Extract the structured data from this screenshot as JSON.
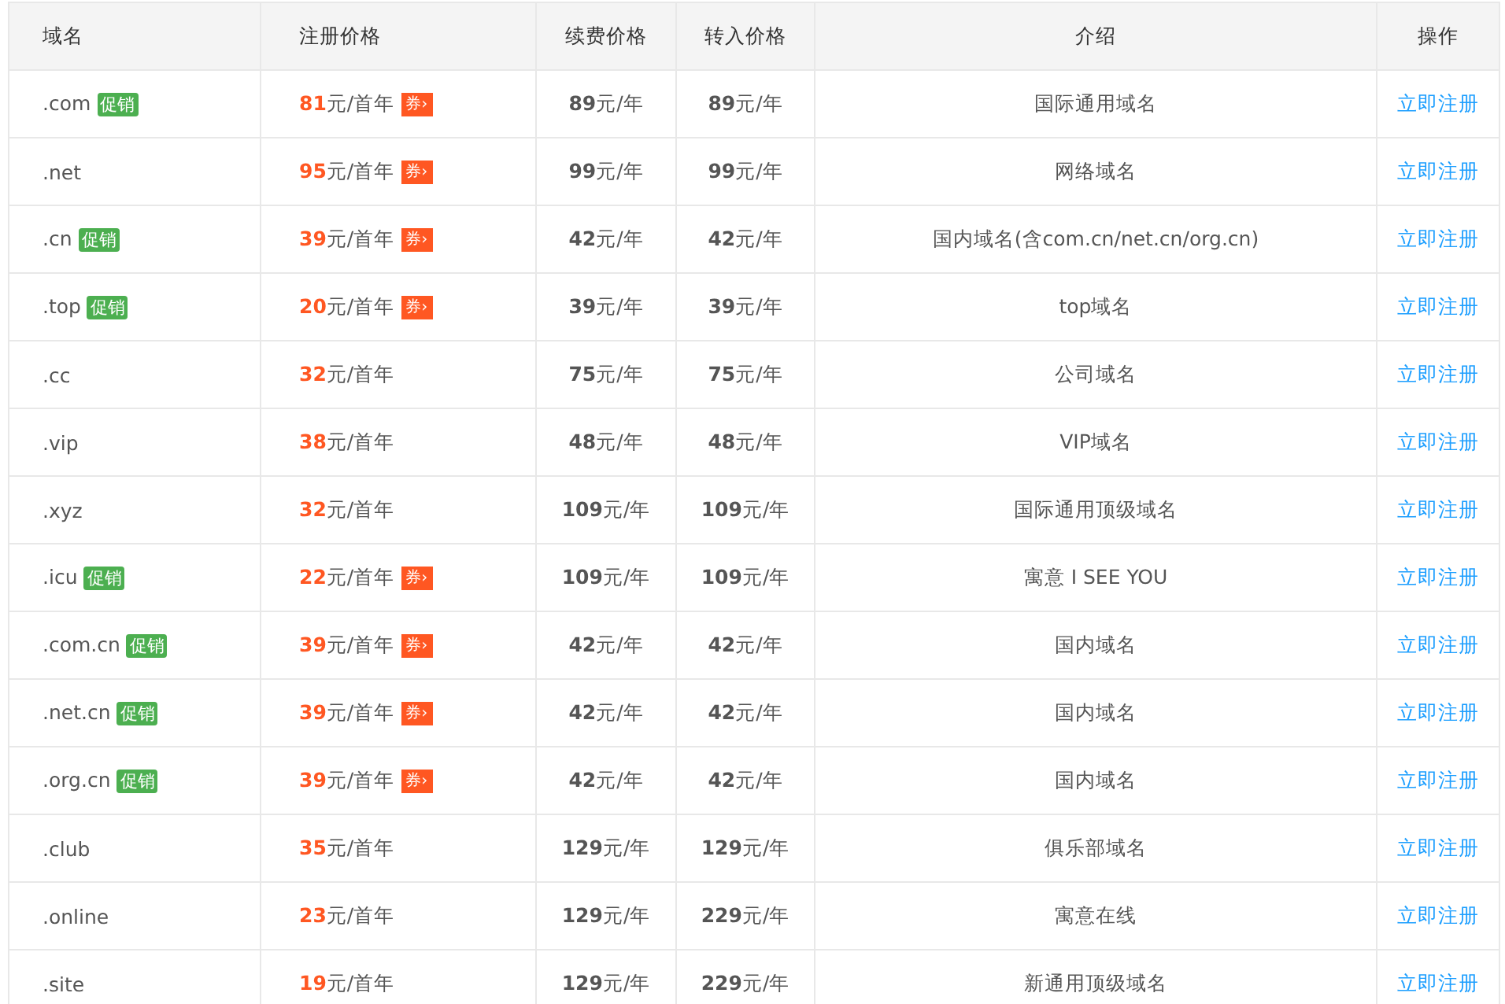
{
  "table": {
    "columns": [
      "域名",
      "注册价格",
      "续费价格",
      "转入价格",
      "介绍",
      "操作"
    ],
    "rows": [
      {
        "domain": ".com",
        "badge": "促销",
        "reg_price": "81",
        "reg_unit": "元/首年",
        "coupon": "券›",
        "renew_price": "89",
        "renew_unit": "元/年",
        "transfer_price": "89",
        "transfer_unit": "元/年",
        "intro": "国际通用域名",
        "action": "立即注册"
      },
      {
        "domain": ".net",
        "reg_price": "95",
        "reg_unit": "元/首年",
        "coupon": "券›",
        "renew_price": "99",
        "renew_unit": "元/年",
        "transfer_price": "99",
        "transfer_unit": "元/年",
        "intro": "网络域名",
        "action": "立即注册"
      },
      {
        "domain": ".cn",
        "badge": "促销",
        "reg_price": "39",
        "reg_unit": "元/首年",
        "coupon": "券›",
        "renew_price": "42",
        "renew_unit": "元/年",
        "transfer_price": "42",
        "transfer_unit": "元/年",
        "intro": "国内域名(含com.cn/net.cn/org.cn)",
        "action": "立即注册"
      },
      {
        "domain": ".top",
        "badge": "促销",
        "reg_price": "20",
        "reg_unit": "元/首年",
        "coupon": "券›",
        "renew_price": "39",
        "renew_unit": "元/年",
        "transfer_price": "39",
        "transfer_unit": "元/年",
        "intro": "top域名",
        "action": "立即注册"
      },
      {
        "domain": ".cc",
        "reg_price": "32",
        "reg_unit": "元/首年",
        "renew_price": "75",
        "renew_unit": "元/年",
        "transfer_price": "75",
        "transfer_unit": "元/年",
        "intro": "公司域名",
        "action": "立即注册"
      },
      {
        "domain": ".vip",
        "reg_price": "38",
        "reg_unit": "元/首年",
        "renew_price": "48",
        "renew_unit": "元/年",
        "transfer_price": "48",
        "transfer_unit": "元/年",
        "intro": "VIP域名",
        "action": "立即注册"
      },
      {
        "domain": ".xyz",
        "reg_price": "32",
        "reg_unit": "元/首年",
        "renew_price": "109",
        "renew_unit": "元/年",
        "transfer_price": "109",
        "transfer_unit": "元/年",
        "intro": "国际通用顶级域名",
        "action": "立即注册"
      },
      {
        "domain": ".icu",
        "badge": "促销",
        "reg_price": "22",
        "reg_unit": "元/首年",
        "coupon": "券›",
        "renew_price": "109",
        "renew_unit": "元/年",
        "transfer_price": "109",
        "transfer_unit": "元/年",
        "intro": "寓意 I SEE YOU",
        "action": "立即注册"
      },
      {
        "domain": ".com.cn",
        "badge": "促销",
        "reg_price": "39",
        "reg_unit": "元/首年",
        "coupon": "券›",
        "renew_price": "42",
        "renew_unit": "元/年",
        "transfer_price": "42",
        "transfer_unit": "元/年",
        "intro": "国内域名",
        "action": "立即注册"
      },
      {
        "domain": ".net.cn",
        "badge": "促销",
        "reg_price": "39",
        "reg_unit": "元/首年",
        "coupon": "券›",
        "renew_price": "42",
        "renew_unit": "元/年",
        "transfer_price": "42",
        "transfer_unit": "元/年",
        "intro": "国内域名",
        "action": "立即注册"
      },
      {
        "domain": ".org.cn",
        "badge": "促销",
        "reg_price": "39",
        "reg_unit": "元/首年",
        "coupon": "券›",
        "renew_price": "42",
        "renew_unit": "元/年",
        "transfer_price": "42",
        "transfer_unit": "元/年",
        "intro": "国内域名",
        "action": "立即注册"
      },
      {
        "domain": ".club",
        "reg_price": "35",
        "reg_unit": "元/首年",
        "renew_price": "129",
        "renew_unit": "元/年",
        "transfer_price": "129",
        "transfer_unit": "元/年",
        "intro": "俱乐部域名",
        "action": "立即注册"
      },
      {
        "domain": ".online",
        "reg_price": "23",
        "reg_unit": "元/首年",
        "renew_price": "129",
        "renew_unit": "元/年",
        "transfer_price": "229",
        "transfer_unit": "元/年",
        "intro": "寓意在线",
        "action": "立即注册"
      },
      {
        "domain": ".site",
        "reg_price": "19",
        "reg_unit": "元/首年",
        "renew_price": "129",
        "renew_unit": "元/年",
        "transfer_price": "229",
        "transfer_unit": "元/年",
        "intro": "新通用顶级域名",
        "action": "立即注册"
      }
    ]
  }
}
